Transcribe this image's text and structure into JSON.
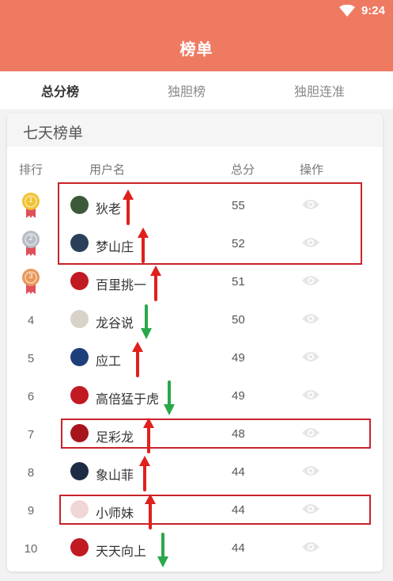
{
  "status": {
    "time": "9:24"
  },
  "appbar": {
    "title": "榜单"
  },
  "tabs": [
    {
      "label": "总分榜",
      "active": true
    },
    {
      "label": "独胆榜",
      "active": false
    },
    {
      "label": "独胆连准",
      "active": false
    }
  ],
  "board": {
    "title": "七天榜单",
    "columns": {
      "rank": "排行",
      "user": "用户名",
      "score": "总分",
      "action": "操作"
    },
    "rows": [
      {
        "rank": "1",
        "name": "狄老",
        "score": "55",
        "medal": "gold",
        "trend": "up",
        "avatar_color": "#3c5a3a"
      },
      {
        "rank": "2",
        "name": "梦山庄",
        "score": "52",
        "medal": "silver",
        "trend": "up",
        "avatar_color": "#2a3f5a"
      },
      {
        "rank": "3",
        "name": "百里挑一",
        "score": "51",
        "medal": "bronze",
        "trend": "up",
        "avatar_color": "#c01a22"
      },
      {
        "rank": "4",
        "name": "龙谷说",
        "score": "50",
        "medal": "",
        "trend": "down",
        "avatar_color": "#d8d2c8"
      },
      {
        "rank": "5",
        "name": "应工",
        "score": "49",
        "medal": "",
        "trend": "up",
        "avatar_color": "#1f3f7a"
      },
      {
        "rank": "6",
        "name": "高倍猛于虎",
        "score": "49",
        "medal": "",
        "trend": "down",
        "avatar_color": "#c01a22"
      },
      {
        "rank": "7",
        "name": "足彩龙",
        "score": "48",
        "medal": "",
        "trend": "up",
        "avatar_color": "#a8141c"
      },
      {
        "rank": "8",
        "name": "象山菲",
        "score": "44",
        "medal": "",
        "trend": "up",
        "avatar_color": "#1c2c44"
      },
      {
        "rank": "9",
        "name": "小师妹",
        "score": "44",
        "medal": "",
        "trend": "up",
        "avatar_color": "#f0d6d6"
      },
      {
        "rank": "10",
        "name": "天天向上",
        "score": "44",
        "medal": "",
        "trend": "down",
        "avatar_color": "#c01a22"
      }
    ]
  },
  "colors": {
    "brand": "#ef7a62",
    "up": "#e0201c",
    "down": "#2aa84a",
    "highlight": "#c8232c"
  }
}
